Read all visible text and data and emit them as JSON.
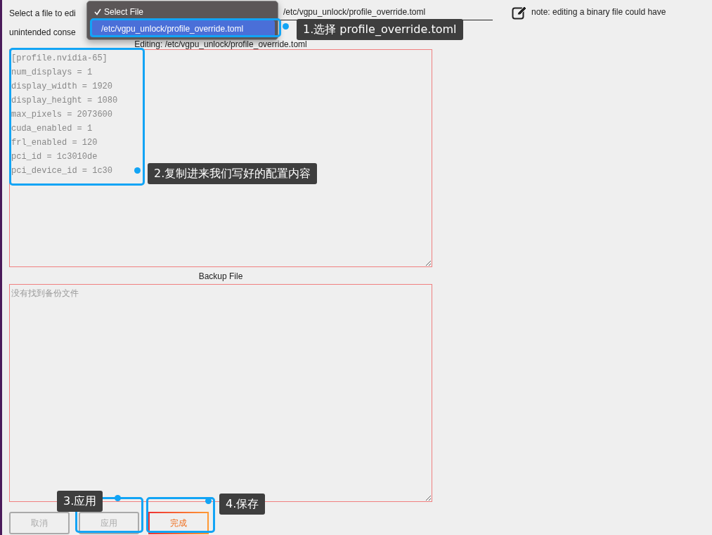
{
  "header": {
    "prompt": "Select a file to edi",
    "select_value": "/etc/vgpu_unlock/profile_override.toml",
    "note": "note: editing a binary file could have",
    "note_continued": "unintended conse"
  },
  "dropdown_menu": {
    "items": [
      {
        "label": "Select File",
        "checked": true,
        "highlighted": false
      },
      {
        "label": "/etc/vgpu_unlock/profile_override.toml",
        "checked": false,
        "highlighted": true
      }
    ]
  },
  "editor": {
    "title": "Editing: /etc/vgpu_unlock/profile_override.toml",
    "lines": [
      "[profile.nvidia-65]",
      "num_displays = 1",
      "display_width = 1920",
      "display_height = 1080",
      "max_pixels = 2073600",
      "cuda_enabled = 1",
      "frl_enabled = 120",
      "pci_id = 1c3010de",
      "pci_device_id = 1c30"
    ]
  },
  "backup": {
    "title": "Backup File",
    "placeholder": "没有找到备份文件"
  },
  "buttons": [
    {
      "label": "取消",
      "disabled": true
    },
    {
      "label": "应用",
      "disabled": true
    },
    {
      "label": "完成",
      "disabled": false
    }
  ],
  "annotations": [
    {
      "label": "1.选择 profile_override.toml"
    },
    {
      "label": "2.复制进来我们写好的配置内容"
    },
    {
      "label": "3.应用"
    },
    {
      "label": "4.保存"
    }
  ]
}
